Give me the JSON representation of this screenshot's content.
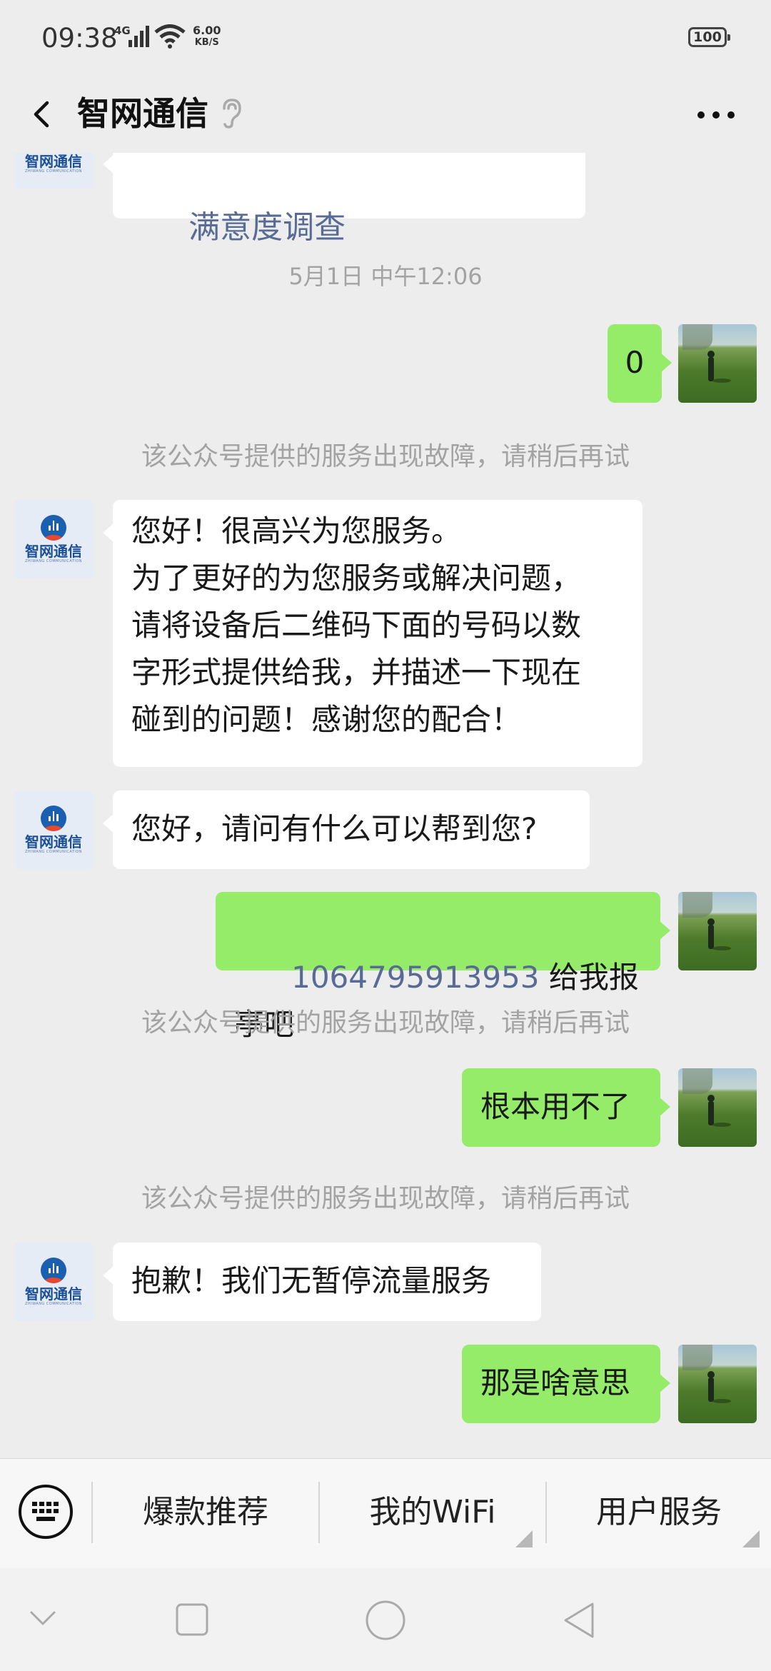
{
  "status_bar": {
    "time": "09:38",
    "network": "4G",
    "speed_value": "6.00",
    "speed_unit": "KB/S",
    "battery": "100"
  },
  "header": {
    "title": "智网通信"
  },
  "messages": {
    "m0": {
      "text": "满意度调查"
    },
    "t1": {
      "text": "5月1日 中午12:06"
    },
    "m1": {
      "text": "0"
    },
    "s1": {
      "text": "该公众号提供的服务出现故障，请稍后再试"
    },
    "m2": {
      "text": "您好！很高兴为您服务。\n为了更好的为您服务或解决问题，\n请将设备后二维码下面的号码以数\n字形式提供给我，并描述一下现在\n碰到的问题！感谢您的配合！"
    },
    "m3": {
      "text": "您好，请问有什么可以帮到您?"
    },
    "m4": {
      "number": "1064795913953",
      "text": " 给我报亭吧"
    },
    "s2": {
      "text": "该公众号提供的服务出现故障，请稍后再试"
    },
    "m5": {
      "text": "根本用不了"
    },
    "s3": {
      "text": "该公众号提供的服务出现故障，请稍后再试"
    },
    "m6": {
      "text": "抱歉！我们无暂停流量服务"
    },
    "m7": {
      "text": "那是啥意思"
    }
  },
  "avatar_oa": {
    "name": "智网通信",
    "sub": "ZHIWANG COMMUNICATION"
  },
  "menu": {
    "item1": "爆款推荐",
    "item2": "我的WiFi",
    "item3": "用户服务"
  },
  "colors": {
    "outgoing_bubble": "#95ec69",
    "incoming_bubble": "#ffffff",
    "link": "#576b95",
    "background": "#ededed"
  }
}
